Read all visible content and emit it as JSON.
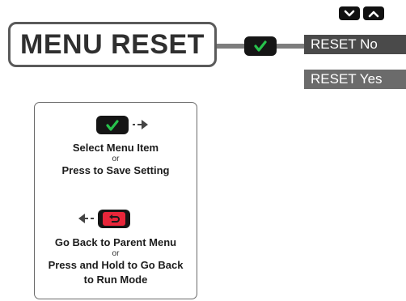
{
  "nav_keys": [
    {
      "icon": "chevron-down-icon"
    },
    {
      "icon": "chevron-up-icon"
    }
  ],
  "menu": {
    "title": "MENU RESET"
  },
  "options": [
    {
      "label": "RESET No",
      "state": "selected"
    },
    {
      "label": "RESET Yes",
      "state": "unselected"
    }
  ],
  "legend": {
    "enter": {
      "icon": "check-icon",
      "line1": "Select Menu Item",
      "or": "or",
      "line2": "Press to Save Setting"
    },
    "back": {
      "icon": "back-arrow-icon",
      "line1": "Go Back to Parent Menu",
      "or": "or",
      "line2": "Press and Hold to Go Back",
      "line3": "to Run Mode"
    }
  },
  "colors": {
    "key_bg": "#151515",
    "check": "#27c24c",
    "back_key_bg": "#e8263a",
    "option_selected_bg": "#4a4a4a",
    "option_bg": "#6b6b6b",
    "box_border": "#5a5a5a"
  }
}
